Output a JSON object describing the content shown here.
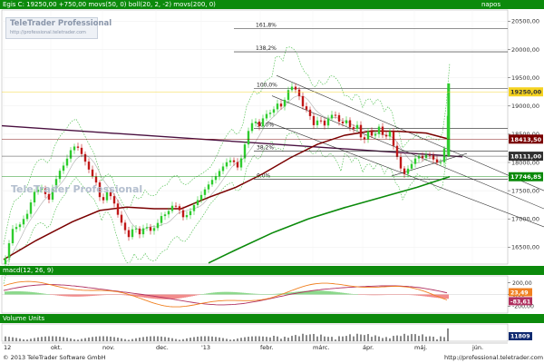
{
  "window": {
    "header_text": "Egis C: 19250,00 +750,00 movs(50, 0) boll(20, 2, -2) movs(200, 0)",
    "period": "napos"
  },
  "watermark": {
    "title": "TeleTrader Professional",
    "url": "http://professional.teletrader.com",
    "body": "TeleTrader Professional"
  },
  "macd_panel": {
    "title": "macd(12, 26, 9)"
  },
  "volume_panel": {
    "title": "Volume Units"
  },
  "footer": {
    "copyright": "© 2013 TeleTrader Software GmbH",
    "url": "http://professional.teletrader.com"
  },
  "colors": {
    "header_bg": "#0c8a0c",
    "price_up": "#2ecc2e",
    "price_down": "#c01818",
    "ma50": "#7a0000",
    "ma200": "#0a8a0a",
    "boll": "#5ec45e",
    "resistance": "#4a1040",
    "label_last": "#27c027"
  },
  "chart_data": {
    "type": "candlestick",
    "x_tick_labels": [
      "12",
      "okt.",
      "nov.",
      "dec.",
      "'13",
      "febr.",
      "márc.",
      "ápr.",
      "máj.",
      "jún."
    ],
    "y_axis": {
      "ticks": [
        "20500,00",
        "20000,00",
        "19500,00",
        "19000,00",
        "18500,00",
        "18000,00",
        "17500,00",
        "17000,00",
        "16500,00"
      ],
      "range": [
        16200,
        20700
      ]
    },
    "fibonacci": [
      {
        "label": "161,8%",
        "value": 20370
      },
      {
        "label": "138,2%",
        "value": 19960
      },
      {
        "label": "100,0%",
        "value": 19310
      },
      {
        "label": "50,0%",
        "value": 18600
      },
      {
        "label": "38,2%",
        "value": 18200
      },
      {
        "label": "0,0%",
        "value": 17700
      }
    ],
    "price_labels": [
      {
        "text": "19250,00",
        "value": 19250,
        "color": "#f5d320"
      },
      {
        "text": "18413,50",
        "value": 18413,
        "color": "#7a0000"
      },
      {
        "text": "18111,00",
        "value": 18111,
        "color": "#303030"
      },
      {
        "text": "17746,85",
        "value": 17747,
        "color": "#0a8a0a"
      }
    ],
    "macd": {
      "ticks": [
        "200,00",
        "0,00",
        "-200,00"
      ],
      "range": [
        -320,
        320
      ],
      "labels": [
        {
          "text": "23,49",
          "value": 23,
          "color": "#f08020"
        },
        {
          "text": "-83,61",
          "value": -84,
          "color": "#b03060"
        }
      ]
    },
    "volume": {
      "label": {
        "text": "11809",
        "color": "#102a70"
      }
    }
  }
}
